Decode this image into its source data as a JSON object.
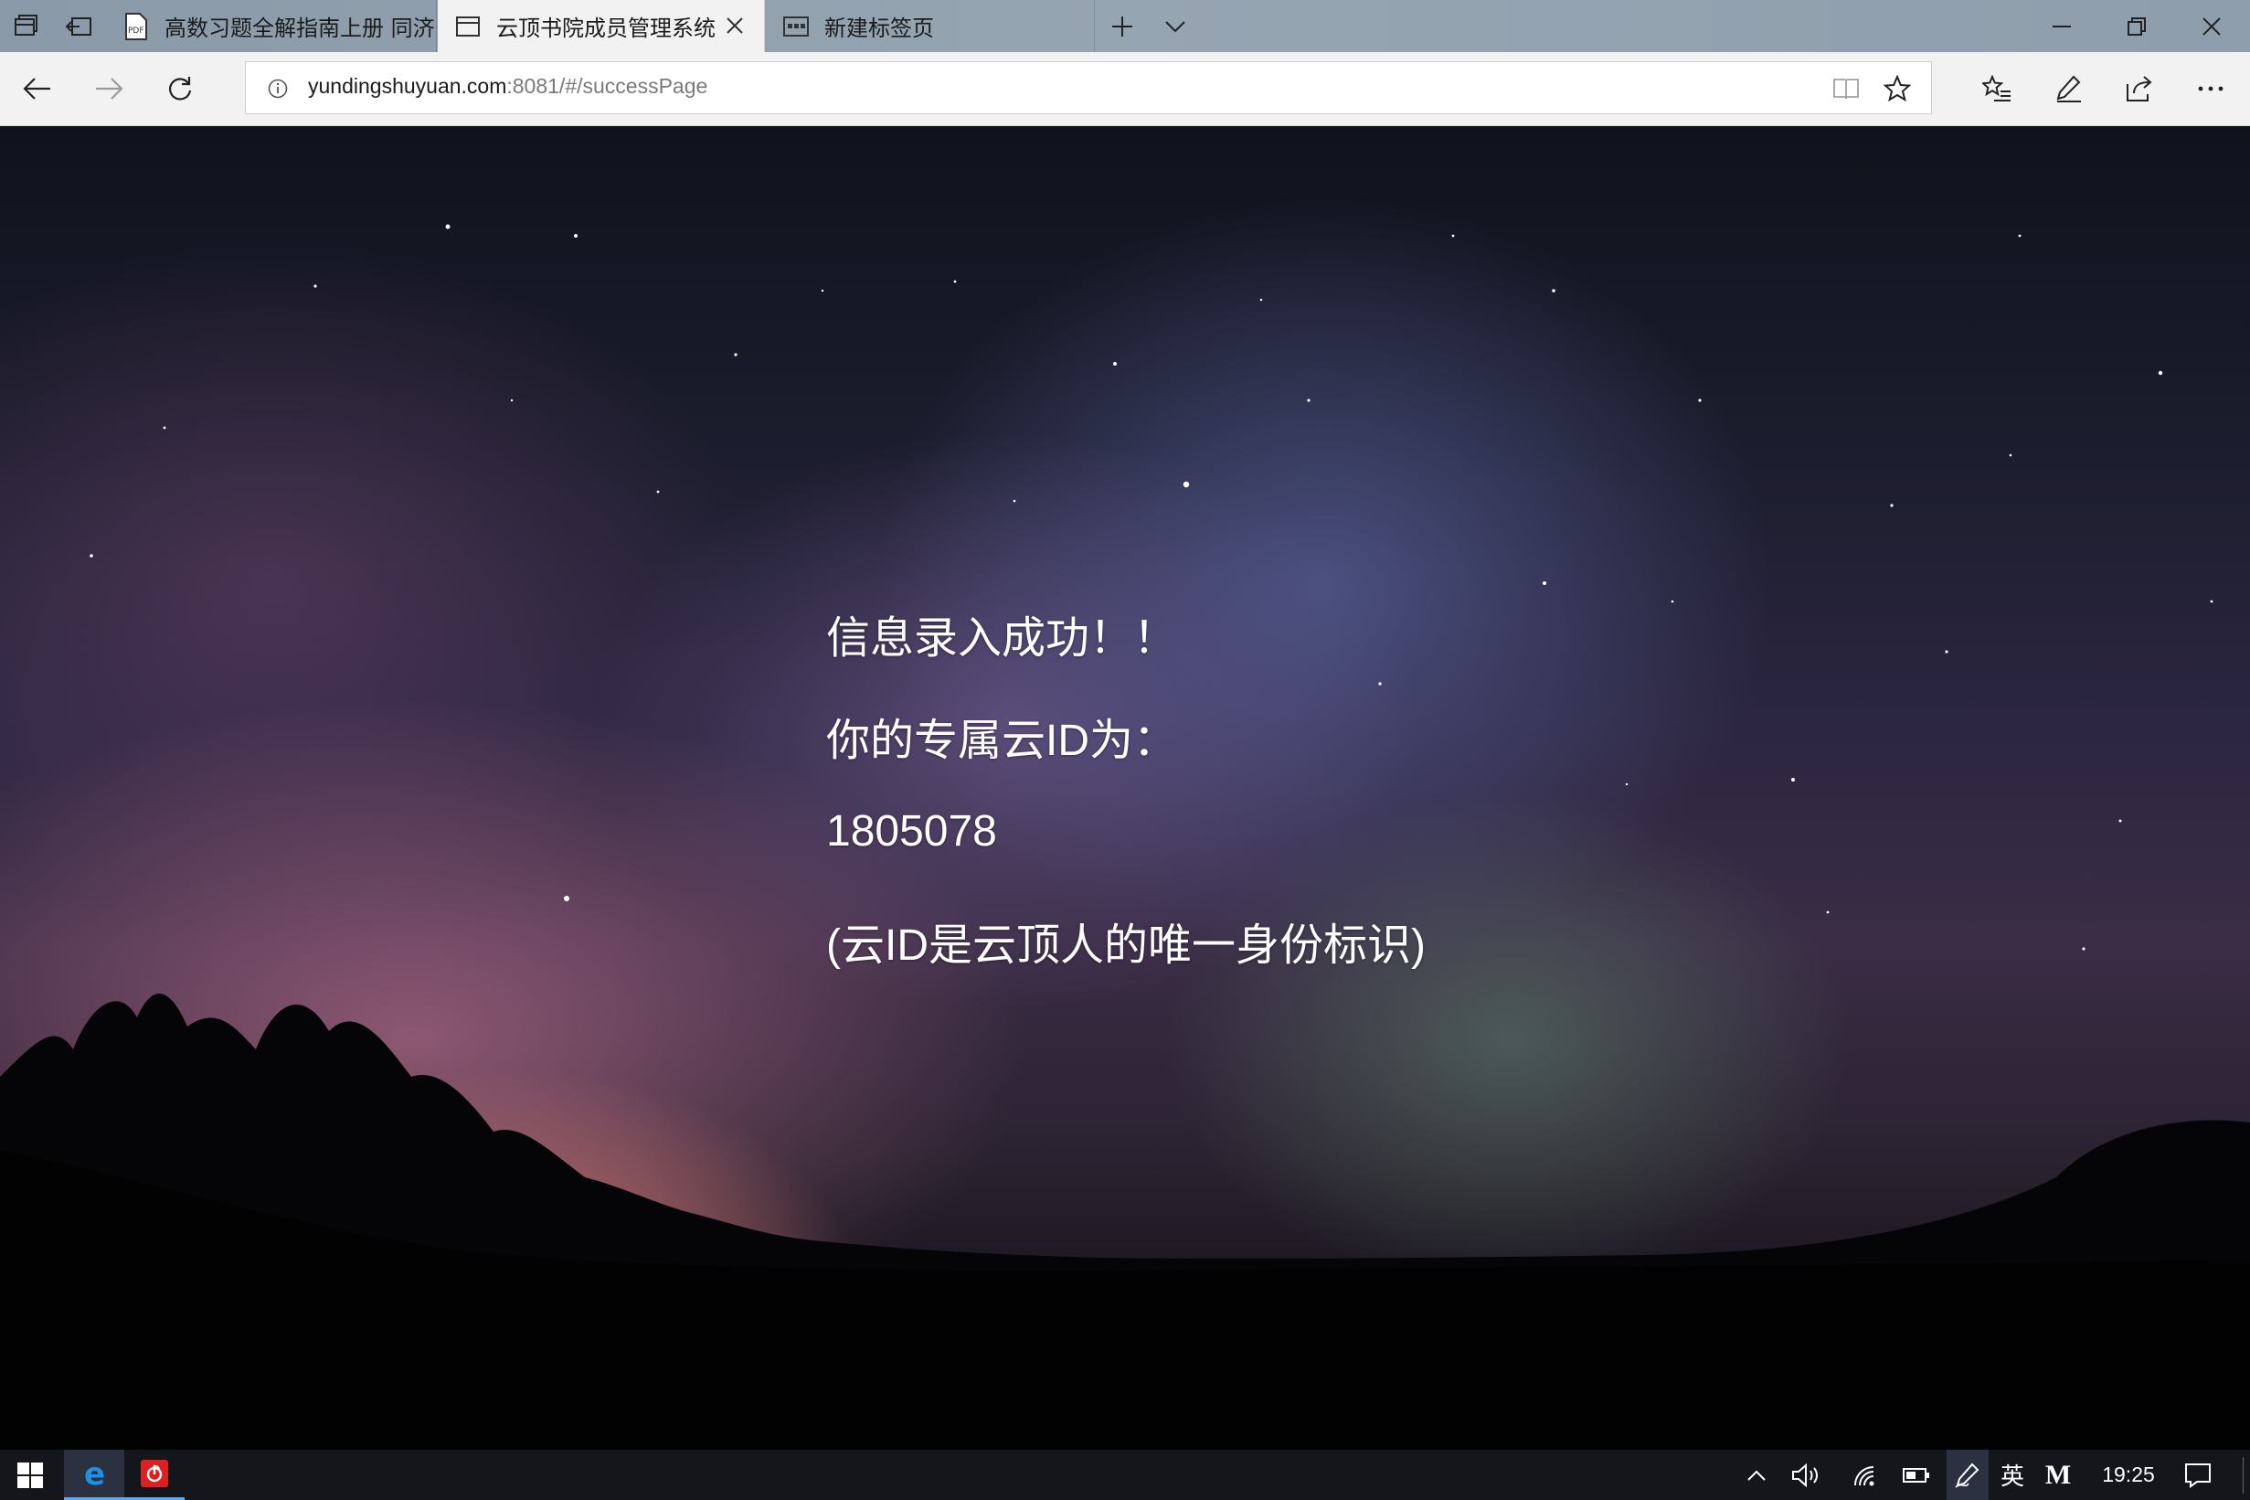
{
  "browser": {
    "tabs": [
      {
        "title": "高数习题全解指南上册 同济",
        "icon": "pdf-icon"
      },
      {
        "title": "云顶书院成员管理系统",
        "icon": "page-icon"
      },
      {
        "title": "新建标签页",
        "icon": "new-tab-page-icon"
      }
    ],
    "url_host": "yundingshuyuan.com",
    "url_path": ":8081/#/successPage"
  },
  "content": {
    "line1": "信息录入成功！！",
    "line2": "你的专属云ID为：",
    "cloud_id": "1805078",
    "line4": "(云ID是云顶人的唯一身份标识)"
  },
  "taskbar": {
    "ime": "英",
    "ime_mode": "M",
    "clock": "19:25"
  },
  "colors": {
    "tab_strip": "#8e9eac",
    "active_tab": "#f2f2f2",
    "taskbar": "#14161c",
    "edge_blue": "#1e90e8",
    "netease_red": "#e02020"
  }
}
